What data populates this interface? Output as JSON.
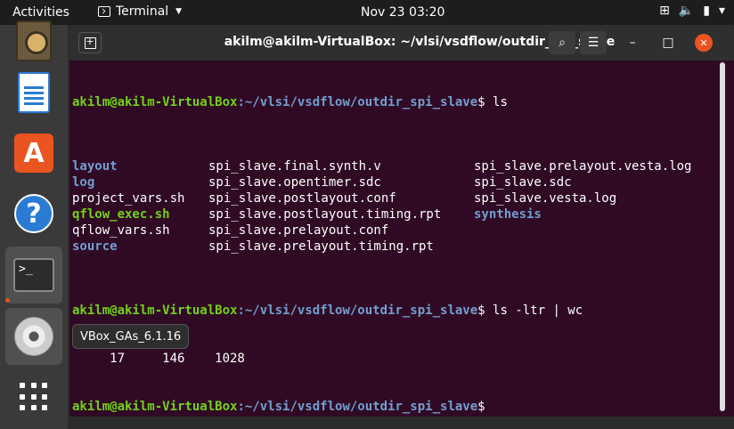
{
  "topbar": {
    "activities": "Activities",
    "app_name": "Terminal",
    "clock": "Nov 23  03:20"
  },
  "dock": {
    "items": [
      "rhythmbox",
      "libreoffice-writer",
      "ubuntu-software",
      "help",
      "terminal",
      "dvd",
      "show-applications"
    ]
  },
  "desktop": {
    "tooltip": "VBox_GAs_6.1.16"
  },
  "window": {
    "title": "akilm@akilm-VirtualBox: ~/vlsi/vsdflow/outdir_spi_slave"
  },
  "terminal": {
    "prompt_user": "akilm@akilm-VirtualBox",
    "prompt_path": ":~/vlsi/vsdflow/outdir_spi_slave",
    "prompt_sign": "$ ",
    "cmd1": "ls",
    "listing": [
      [
        "layout",
        "spi_slave.final.synth.v",
        "spi_slave.prelayout.vesta.log"
      ],
      [
        "log",
        "spi_slave.opentimer.sdc",
        "spi_slave.sdc"
      ],
      [
        "project_vars.sh",
        "spi_slave.postlayout.conf",
        "spi_slave.vesta.log"
      ],
      [
        "qflow_exec.sh",
        "spi_slave.postlayout.timing.rpt",
        "synthesis"
      ],
      [
        "qflow_vars.sh",
        "spi_slave.prelayout.conf",
        ""
      ],
      [
        "source",
        "spi_slave.prelayout.timing.rpt",
        ""
      ]
    ],
    "cmd2": "ls -ltr | wc",
    "wc_output": "     17     146    1028"
  },
  "colors": {
    "terminal_bg": "#300a24",
    "prompt_user": "#73d216",
    "prompt_path": "#729fcf",
    "accent": "#e95420"
  }
}
